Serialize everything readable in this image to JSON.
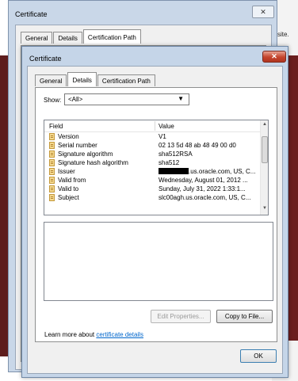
{
  "background": {
    "right_text_top": "",
    "right_text": "site."
  },
  "back_window": {
    "title": "Certificate",
    "close_label": "✕",
    "tabs": [
      "General",
      "Details",
      "Certification Path"
    ],
    "active_tab": "Certification Path"
  },
  "front_window": {
    "title": "Certificate",
    "close_label": "✕",
    "tabs": [
      "General",
      "Details",
      "Certification Path"
    ],
    "active_tab": "Details",
    "show_label": "Show:",
    "show_value": "<All>",
    "columns": {
      "field": "Field",
      "value": "Value"
    },
    "rows": [
      {
        "field": "Version",
        "value": "V1"
      },
      {
        "field": "Serial number",
        "value": "02 13 5d 48 ab 48 49 00 d0"
      },
      {
        "field": "Signature algorithm",
        "value": "sha512RSA"
      },
      {
        "field": "Signature hash algorithm",
        "value": "sha512"
      },
      {
        "field": "Issuer",
        "value": ".us.oracle.com, US, C..."
      },
      {
        "field": "Valid from",
        "value": "Wednesday, August 01, 2012 ..."
      },
      {
        "field": "Valid to",
        "value": "Sunday, July 31, 2022 1:33:1..."
      },
      {
        "field": "Subject",
        "value": "slc00agh.us.oracle.com, US, C..."
      }
    ],
    "edit_properties_label": "Edit Properties...",
    "copy_to_file_label": "Copy to File...",
    "learn_more_prefix": "Learn more about ",
    "learn_more_link": "certificate details",
    "ok_label": "OK"
  },
  "colors": {
    "window_frame": "#c5d5e8",
    "close_button": "#c4442c",
    "link": "#0066cc",
    "desktop_dark": "#6a1e1e"
  }
}
